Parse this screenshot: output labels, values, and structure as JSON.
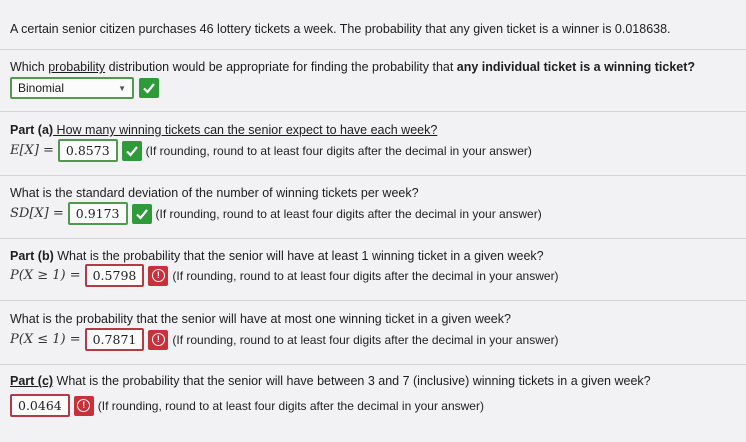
{
  "intro": "A certain senior citizen purchases 46 lottery tickets a week. The probability that any given ticket is a winner is 0.018638.",
  "q0": {
    "prefix": "Which ",
    "prob_word": "probability",
    "mid": " distribution would be appropriate for finding the probability that ",
    "bold": "any individual ticket is a winning ticket?",
    "selected": "Binomial"
  },
  "partA": {
    "label": "Part (a)",
    "question": " How many winning tickets can the senior expect to have each week?",
    "expr": "E[X] =",
    "answer": "0.8573",
    "note": "(If rounding, round to at least four digits after the decimal in your answer)"
  },
  "partA2": {
    "question": "What is the standard deviation of the number of winning tickets per week?",
    "expr": "SD[X] =",
    "answer": "0.9173",
    "note": "(If rounding, round to at least four digits after the decimal in your answer)"
  },
  "partB": {
    "label": "Part (b)",
    "question": " What is the probability that the senior will have at least 1 winning ticket in a given week?",
    "expr": "P(X ≥ 1) =",
    "answer": "0.5798",
    "note": "(If rounding, round to at least four digits after the decimal in your answer)"
  },
  "partB2": {
    "question": "What is the probability that the senior will have at most one winning ticket in a given week?",
    "expr": "P(X ≤ 1) =",
    "answer": "0.7871",
    "note": "(If rounding, round to at least four digits after the decimal in your answer)"
  },
  "partC": {
    "label": "Part (c)",
    "question": " What is the probability that the senior will have between 3 and 7 (inclusive) winning tickets in a given week?",
    "answer": "0.0464",
    "note": "(If rounding, round to at least four digits after the decimal in your answer)"
  },
  "colors": {
    "correct": "#2e9a39",
    "incorrect": "#c8303a",
    "correct_border": "#4f9a4f",
    "incorrect_border": "#b43b46"
  },
  "icons": {
    "correct": "checkmark-icon",
    "incorrect": "alert-icon",
    "dropdown": "chevron-down-icon"
  }
}
